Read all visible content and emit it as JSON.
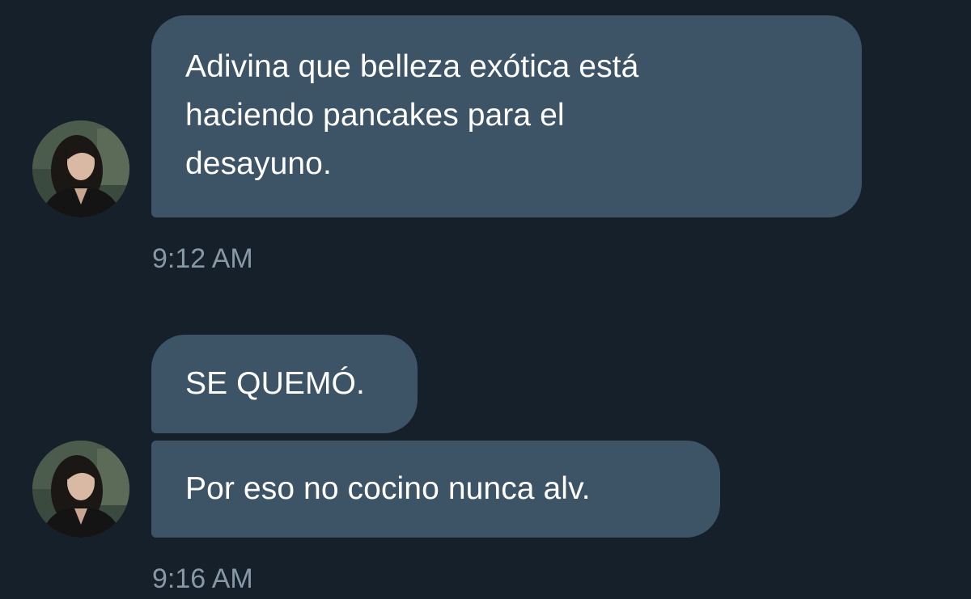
{
  "messages": [
    {
      "text": "Adivina que belleza exótica está haciendo pancakes para el desayuno.",
      "lines": [
        "Adivina que belleza exótica está",
        "haciendo pancakes para el",
        "desayuno."
      ]
    },
    {
      "text": "SE QUEMÓ."
    },
    {
      "text": "Por eso no cocino nunca alv."
    }
  ],
  "timestamps": [
    "9:12 AM",
    "9:16 AM"
  ],
  "colors": {
    "background": "#15202b",
    "bubble": "#3d5466",
    "timestamp": "#8899a6",
    "text": "#ffffff"
  },
  "icons": [
    "avatar-photo"
  ]
}
